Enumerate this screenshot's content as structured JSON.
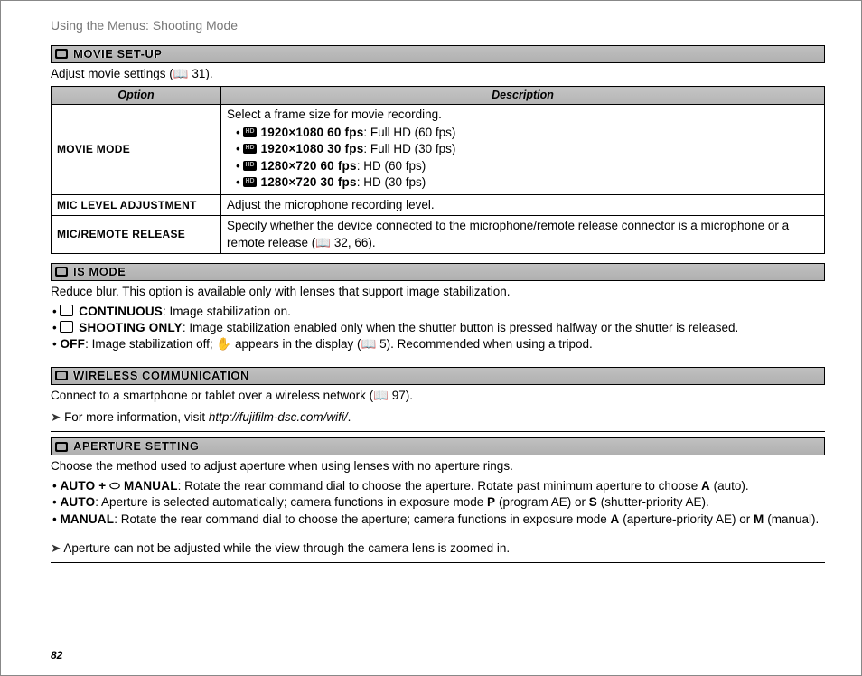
{
  "header": "Using the Menus: Shooting Mode",
  "pagenum": "82",
  "sections": {
    "movie_setup": {
      "title": "MOVIE SET-UP",
      "sub": "Adjust movie settings (📖 31).",
      "th_option": "Option",
      "th_desc": "Description",
      "rows": {
        "movie_mode": {
          "label": "MOVIE MODE",
          "lead": "Select a frame size for movie recording.",
          "items": [
            {
              "b": "1920×1080 60 fps",
              "t": ": Full HD (60 fps)"
            },
            {
              "b": "1920×1080 30 fps",
              "t": ": Full HD (30 fps)"
            },
            {
              "b": "1280×720 60 fps",
              "t": ": HD (60 fps)"
            },
            {
              "b": "1280×720 30 fps",
              "t": ": HD (30 fps)"
            }
          ]
        },
        "mic_level": {
          "label": "MIC LEVEL ADJUSTMENT",
          "desc": "Adjust the microphone recording level."
        },
        "mic_remote": {
          "label": "MIC/REMOTE RELEASE",
          "desc": "Specify whether the device connected to the microphone/remote release connector is a microphone or a remote release (📖 32, 66)."
        }
      }
    },
    "is_mode": {
      "title": "IS MODE",
      "sub": "Reduce blur.  This option is available only with lenses that support image stabilization.",
      "items": [
        {
          "b": "CONTINUOUS",
          "t": ": Image stabilization on."
        },
        {
          "b": "SHOOTING ONLY",
          "t": ": Image stabilization enabled only when the shutter button is pressed halfway or the shutter is released."
        },
        {
          "b": "OFF",
          "t": ": Image stabilization off; ✋ appears in the display (📖 5).  Recommended when using a tripod."
        }
      ]
    },
    "wireless": {
      "title": "WIRELESS COMMUNICATION",
      "sub": "Connect to a smartphone or tablet over a wireless network (📖 97).",
      "note_pre": "For more information, visit ",
      "note_link": "http://fujifilm-dsc.com/wifi/",
      "note_post": "."
    },
    "aperture": {
      "title": "APERTURE SETTING",
      "sub": "Choose the method used to adjust aperture when using lenses with no aperture rings.",
      "items": [
        {
          "b": "AUTO + ⬭ MANUAL",
          "t": ": Rotate the rear command dial to choose the aperture. Rotate past minimum aperture to choose ",
          "b2": "A",
          "t2": " (auto)."
        },
        {
          "b": "AUTO",
          "t": ": Aperture is selected automatically; camera functions in exposure mode ",
          "b2": "P",
          "t2": " (program AE) or ",
          "b3": "S",
          "t3": " (shutter-priority AE)."
        },
        {
          "b": "MANUAL",
          "t": ": Rotate the rear command dial to choose the aperture; camera functions in exposure mode ",
          "b2": "A",
          "t2": " (aperture-priority AE) or ",
          "b3": "M",
          "t3": " (manual)."
        }
      ],
      "note": "Aperture can not be adjusted while the view through the camera lens is zoomed in."
    }
  }
}
